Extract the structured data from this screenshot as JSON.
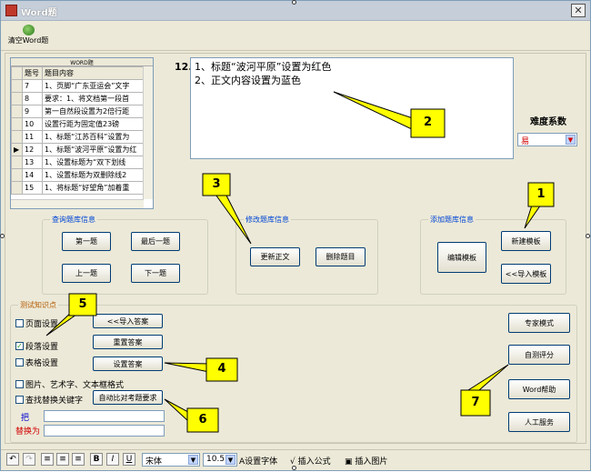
{
  "window": {
    "title": "Word题"
  },
  "toolbar": {
    "clear_label": "清空Word题"
  },
  "grid": {
    "caption": "WORD题",
    "columns": [
      "题号",
      "题目内容"
    ],
    "rows": [
      {
        "id": "7",
        "text": "1、页脚“广东亚运会”文字"
      },
      {
        "id": "8",
        "text": "要求：1、将文档第一段首"
      },
      {
        "id": "9",
        "text": "第一自然段设置为2倍行距"
      },
      {
        "id": "10",
        "text": "设置行距为固定值23磅"
      },
      {
        "id": "11",
        "text": "1、标题“江苏百科”设置为"
      },
      {
        "id": "12",
        "text": "1、标题“波河平原”设置为红"
      },
      {
        "id": "13",
        "text": "1、设置标题为“双下划线"
      },
      {
        "id": "14",
        "text": "1、设置标题为双删除线2"
      },
      {
        "id": "15",
        "text": "1、将标题“好望角”加着重"
      }
    ],
    "current_row_marker": "▶"
  },
  "question": {
    "number": "12.",
    "lines": [
      "1、标题“波河平原”设置为红色",
      "2、正文内容设置为蓝色"
    ]
  },
  "difficulty": {
    "label": "难度系数",
    "value": "易"
  },
  "query_group": {
    "legend": "查询题库信息",
    "first": "第一题",
    "last": "最后一题",
    "prev": "上一题",
    "next": "下一题"
  },
  "modify_group": {
    "legend": "修改题库信息",
    "update": "更新正文",
    "delete": "删除题目"
  },
  "add_group": {
    "legend": "添加题库信息",
    "edit_template": "编辑模板",
    "new_template": "新建模板",
    "import_template": "<<导入模板"
  },
  "knowledge_group": {
    "legend": "测试知识点",
    "items": [
      {
        "label": "页面设置",
        "checked": false
      },
      {
        "label": "段落设置",
        "checked": true
      },
      {
        "label": "表格设置",
        "checked": false
      },
      {
        "label": "图片、艺术字、文本框格式",
        "checked": false
      },
      {
        "label": "查找替换关键字",
        "checked": false
      }
    ],
    "import_answer": "<<导入答案",
    "reset_answer": "重置答案",
    "set_answer": "设置答案",
    "auto_compare": "自动比对考题要求",
    "find_label": "把",
    "replace_label": "替换为"
  },
  "right_buttons": {
    "expert": "专家模式",
    "self_score": "自测评分",
    "word_help": "Word帮助",
    "manual_service": "人工服务"
  },
  "callouts": [
    "1",
    "2",
    "3",
    "4",
    "5",
    "6",
    "7"
  ],
  "bottom": {
    "font": "宋体",
    "size": "10.5",
    "set_font": "设置字体",
    "insert_formula": "插入公式",
    "insert_image": "插入图片",
    "bold": "B",
    "italic": "I",
    "underline": "U"
  }
}
